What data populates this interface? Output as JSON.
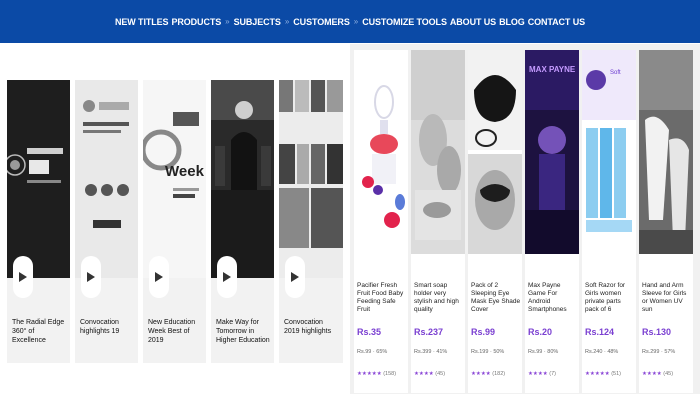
{
  "nav": {
    "items": [
      {
        "label": "NEW TITLES",
        "sep_after": false
      },
      {
        "label": "PRODUCTS",
        "sep_after": true
      },
      {
        "label": "SUBJECTS",
        "sep_after": true
      },
      {
        "label": "CUSTOMERS",
        "sep_after": true
      },
      {
        "label": "CUSTOMIZE TOOLS",
        "sep_after": false
      },
      {
        "label": "ABOUT US",
        "sep_after": false
      },
      {
        "label": "BLOG",
        "sep_after": false
      },
      {
        "label": "CONTACT US",
        "sep_after": false
      }
    ],
    "separator": "»"
  },
  "videos": [
    {
      "title": "The Radial Edge 360° of Excellence",
      "overlay": "THE RADIAL EDGE 360°"
    },
    {
      "title": "Convocation highlights 19",
      "overlay": "The Convocation of 2020 GFC"
    },
    {
      "title": "New Education Week Best of 2019",
      "overlay": "Week"
    },
    {
      "title": "Make Way for Tomorrow in Higher Education",
      "overlay": ""
    },
    {
      "title": "Convocation 2019 highlights",
      "overlay": ""
    }
  ],
  "products": [
    {
      "name": "Pacifier Fresh Fruit Food Baby Feeding Safe Fruit",
      "price": "Rs.35",
      "mrp": "Rs.99 · 65%",
      "rating": "★★★★★",
      "count": "(158)"
    },
    {
      "name": "Smart soap holder very stylish and high quality",
      "price": "Rs.237",
      "mrp": "Rs.399 · 41%",
      "rating": "★★★★",
      "count": "(45)"
    },
    {
      "name": "Pack of 2 Sleeping Eye Mask Eye Shade Cover",
      "price": "Rs.99",
      "mrp": "Rs.199 · 50%",
      "rating": "★★★★",
      "count": "(182)"
    },
    {
      "name": "Max Payne Game For Android Smartphones",
      "price": "Rs.20",
      "mrp": "Rs.99 · 80%",
      "rating": "★★★★",
      "count": "(7)"
    },
    {
      "name": "Soft Razor for Girls women private parts pack of 6",
      "price": "Rs.124",
      "mrp": "Rs.240 · 48%",
      "rating": "★★★★★",
      "count": "(51)"
    },
    {
      "name": "Hand and Arm Sleeve for Girls or Women UV sun",
      "price": "Rs.130",
      "mrp": "Rs.299 · 57%",
      "rating": "★★★★",
      "count": "(45)"
    }
  ]
}
